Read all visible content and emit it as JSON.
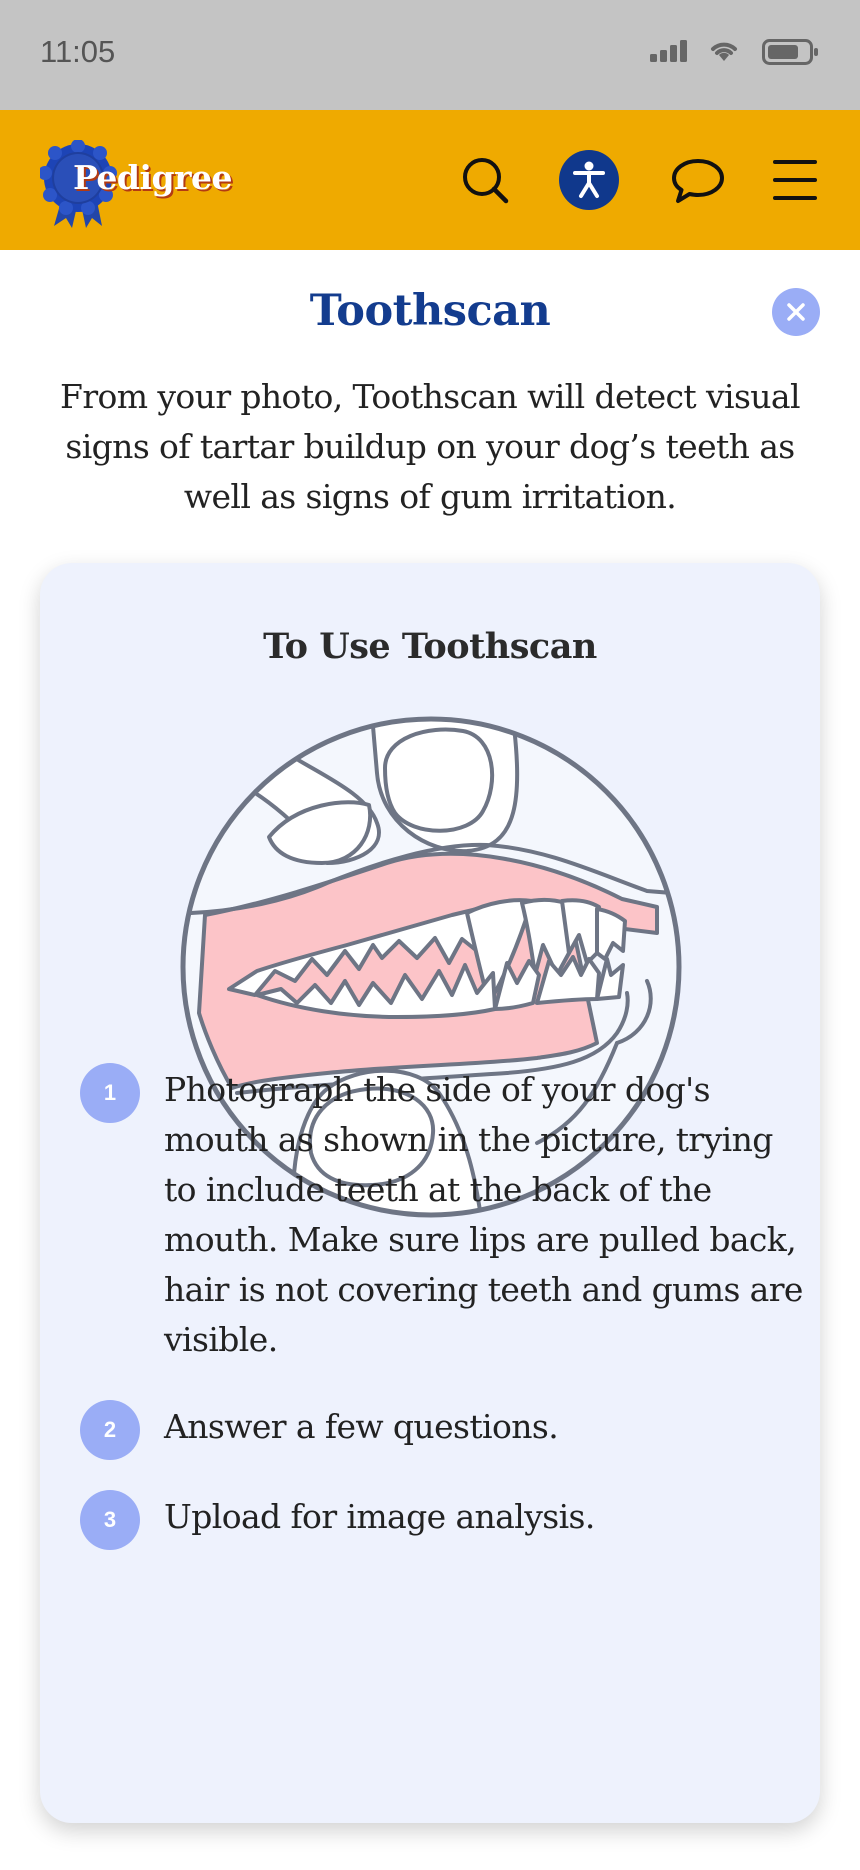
{
  "status_bar": {
    "time": "11:05",
    "icons": [
      "signal-icon",
      "wifi-icon",
      "battery-icon"
    ]
  },
  "header": {
    "logo_text": "Pedigree",
    "icons": [
      "search-icon",
      "accessibility-icon",
      "chat-icon",
      "menu-icon"
    ]
  },
  "page": {
    "title": "Toothscan",
    "intro": "From your photo, Toothscan will detect visual signs of tartar buildup on your dog’s teeth as well as signs of gum irritation."
  },
  "card": {
    "title": "To Use Toothscan",
    "steps": [
      {
        "number": "1",
        "text": "Photograph the side of your dog's mouth as shown in the picture, trying to include teeth at the back of the mouth. Make sure lips are pulled back, hair is not covering teeth and gums are visible."
      },
      {
        "number": "2",
        "text": "Answer a few questions."
      },
      {
        "number": "3",
        "text": "Upload for image analysis."
      }
    ]
  },
  "colors": {
    "header_bg": "#efaa00",
    "title": "#133c8e",
    "accent": "#9aadf6",
    "card_bg": "#eef2fd",
    "accessibility_bg": "#10388c",
    "gum": "#fcc4c8",
    "outline": "#6e7585"
  }
}
